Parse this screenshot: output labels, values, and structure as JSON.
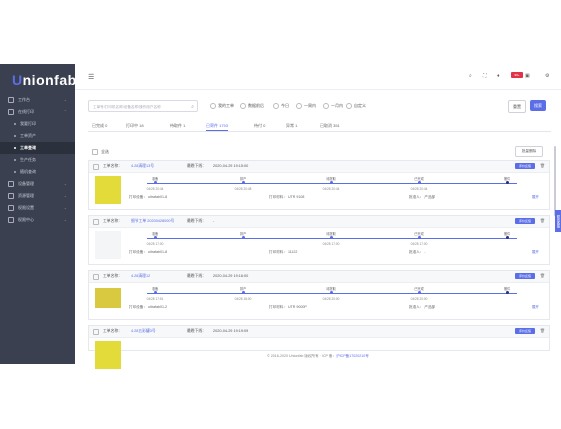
{
  "brand": {
    "logo_main": "nionfab",
    "logo_u": "U"
  },
  "sidebar": {
    "items": [
      {
        "label": "工作台",
        "icon": "dashboard-icon",
        "chev": "⌄"
      },
      {
        "label": "在线打印",
        "icon": "printer-icon",
        "chev": "⌃"
      },
      {
        "label": "我要打印",
        "sub": true
      },
      {
        "label": "工单资产",
        "sub": true
      },
      {
        "label": "工单查询",
        "sub": true,
        "active": true
      },
      {
        "label": "生产任务",
        "sub": true
      },
      {
        "label": "随机查询",
        "sub": true
      },
      {
        "label": "设备管理",
        "icon": "device-icon",
        "chev": "⌄"
      },
      {
        "label": "资源管理",
        "icon": "resource-icon",
        "chev": "⌄"
      },
      {
        "label": "权限设置",
        "icon": "permission-icon",
        "chev": "⌄"
      },
      {
        "label": "权限中心",
        "icon": "center-icon",
        "chev": "⌄"
      }
    ]
  },
  "topbar": {
    "badge": "99+"
  },
  "filters": {
    "search_placeholder": "工单号/打印机名称/设备名称/操作用户名称",
    "radios": [
      "我的工单",
      "数据前后",
      "今日",
      "一周内",
      "一月内",
      "自定义"
    ],
    "reset": "重置",
    "search": "搜索"
  },
  "tabs": [
    {
      "label": "已完成 0"
    },
    {
      "label": "打印中 18"
    },
    {
      "label": "待取件 1"
    },
    {
      "label": "已寄件 1793",
      "active": true
    },
    {
      "label": "待付 0"
    },
    {
      "label": "异常 1"
    },
    {
      "label": "已取消 351"
    }
  ],
  "list": {
    "select_all": "全选",
    "batch_delete": "批量删除"
  },
  "colors": {
    "accent": "#5b6ee8",
    "sidebar": "#3a4050"
  },
  "cards": [
    {
      "name_label": "工单名称：",
      "name": "4.28清理13号",
      "printer_label": "最晚下线：",
      "printer": "2020-04-29 19:15:00",
      "thumb": "yellow",
      "stages": [
        {
          "t": "准备",
          "d": "04/28 20:44"
        },
        {
          "t": "排产",
          "d": "04/28 20:48"
        },
        {
          "t": "待提取",
          "d": "04/28 20:44"
        },
        {
          "t": "已完成",
          "d": "04/28 20:44"
        },
        {
          "t": "撤件",
          "d": ""
        }
      ],
      "meta": [
        "打印设备：  ultrafab01-8",
        "打印材料：  UTR 9108",
        "批准人：  产品部"
      ],
      "expand": "展开",
      "pill": "评价反馈"
    },
    {
      "name_label": "工单名称：",
      "name": "细节工单 20200428000号",
      "printer_label": "最晚下线：",
      "printer": "-",
      "thumb": "gray",
      "stages": [
        {
          "t": "准备",
          "d": "04/28 17:00"
        },
        {
          "t": "排产",
          "d": ""
        },
        {
          "t": "待提取",
          "d": "04/28 17:00"
        },
        {
          "t": "已完成",
          "d": "04/28 17:00"
        },
        {
          "t": "撤件",
          "d": ""
        }
      ],
      "meta": [
        "打印设备：  ultrafab01-8",
        "打印材料：  11122",
        "批准人：  -"
      ],
      "expand": "展开",
      "pill": "评价反馈"
    },
    {
      "name_label": "工单名称：",
      "name": "4.28清理12",
      "printer_label": "最晚下线：",
      "printer": "2020-04-29 19:16:00",
      "thumb": "strip",
      "stages": [
        {
          "t": "准备",
          "d": "04/28 17:51"
        },
        {
          "t": "排产",
          "d": "04/28 18:00"
        },
        {
          "t": "待提取",
          "d": "04/28 20:00"
        },
        {
          "t": "已完成",
          "d": "04/28 20:00"
        },
        {
          "t": "撤件",
          "d": ""
        }
      ],
      "meta": [
        "打印设备：  ultrafab01-2",
        "打印材料：  UTR 9000P",
        "批准人：  产品部"
      ],
      "expand": "展开",
      "pill": "评价反馈"
    },
    {
      "name_label": "工单名称：",
      "name": "4.28五彩罐3号",
      "printer_label": "最晚下线：",
      "printer": "2020-04-29 19:19:09",
      "thumb": "yellow",
      "stages": [],
      "meta": [],
      "expand": "",
      "pill": "评价反馈"
    }
  ],
  "footer": {
    "copy": "© 2016-2020 Unionfab 版权所有  · ICP 备：",
    "icp": "沪ICP备17020210号"
  },
  "float_tab": "联系客服"
}
